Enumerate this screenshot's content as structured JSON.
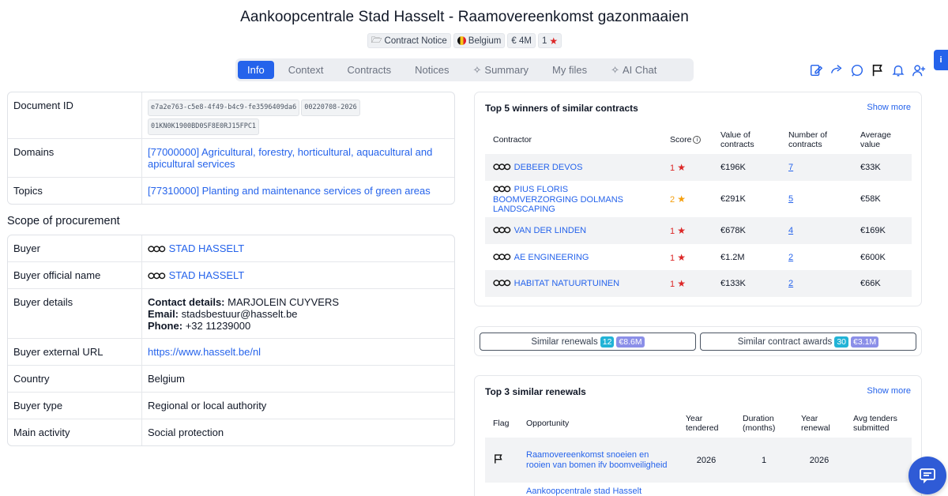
{
  "title": "Aankoopcentrale Stad Hasselt - Raamovereenkomst gazonmaaien",
  "badges": {
    "type": "Contract Notice",
    "country": "Belgium",
    "value": "€ 4M",
    "score": "1"
  },
  "tabs": [
    "Info",
    "Context",
    "Contracts",
    "Notices",
    "Summary",
    "My files",
    "AI Chat"
  ],
  "actions": [
    "edit-icon",
    "share-icon",
    "comment-icon",
    "flag-icon",
    "bell-icon",
    "add-user-icon"
  ],
  "info_tab": "i",
  "details": {
    "document_id_label": "Document ID",
    "document_ids": [
      "e7a2e763-c5e8-4f49-b4c9-fe3596409da6",
      "00220708-2026",
      "01KN0K1900BD0SF8E0RJ15FPC1"
    ],
    "domains_label": "Domains",
    "domains_value": "[77000000] Agricultural, forestry, horticultural, aquacultural and apicultural services",
    "topics_label": "Topics",
    "topics_value": "[77310000] Planting and maintenance services of green areas"
  },
  "scope": {
    "title": "Scope of procurement",
    "buyer_label": "Buyer",
    "buyer_value": "STAD HASSELT",
    "official_name_label": "Buyer official name",
    "official_name_value": "STAD HASSELT",
    "details_label": "Buyer details",
    "contact_label": "Contact details:",
    "contact_value": "MARJOLEIN CUYVERS",
    "email_label": "Email:",
    "email_value": "stadsbestuur@hasselt.be",
    "phone_label": "Phone:",
    "phone_value": "+32 11239000",
    "url_label": "Buyer external URL",
    "url_value": "https://www.hasselt.be/nl",
    "country_label": "Country",
    "country_value": "Belgium",
    "type_label": "Buyer type",
    "type_value": "Regional or local authority",
    "activity_label": "Main activity",
    "activity_value": "Social protection"
  },
  "winners": {
    "title": "Top 5 winners of similar contracts",
    "show_more": "Show more",
    "headers": [
      "Contractor",
      "Score",
      "Value of contracts",
      "Number of contracts",
      "Average value"
    ],
    "rows": [
      {
        "name": "DEBEER DEVOS",
        "score": "1",
        "value": "€196K",
        "count": "7",
        "avg": "€33K"
      },
      {
        "name": "PIUS FLORIS BOOMVERZORGING DOLMANS LANDSCAPING",
        "score": "2",
        "value": "€291K",
        "count": "5",
        "avg": "€58K"
      },
      {
        "name": "VAN DER LINDEN",
        "score": "1",
        "value": "€678K",
        "count": "4",
        "avg": "€169K"
      },
      {
        "name": "AE ENGINEERING",
        "score": "1",
        "value": "€1.2M",
        "count": "2",
        "avg": "€600K"
      },
      {
        "name": "HABITAT NATUURTUINEN",
        "score": "1",
        "value": "€133K",
        "count": "2",
        "avg": "€66K"
      }
    ]
  },
  "similar": {
    "renewals_label": "Similar renewals",
    "renewals_count": "12",
    "renewals_amount": "€8.6M",
    "awards_label": "Similar contract awards",
    "awards_count": "30",
    "awards_amount": "€3.1M"
  },
  "renewals": {
    "title": "Top 3 similar renewals",
    "show_more": "Show more",
    "headers": [
      "Flag",
      "Opportunity",
      "Year tendered",
      "Duration (months)",
      "Year renewal",
      "Avg tenders submitted"
    ],
    "rows": [
      {
        "opportunity": "Raamovereenkomst snoeien en rooien van bomen ifv boomveiligheid",
        "year": "2026",
        "duration": "1",
        "renewal": "2026",
        "avg": ""
      },
      {
        "opportunity": "Aankoopcentrale stad Hasselt",
        "year": "",
        "duration": "",
        "renewal": "",
        "avg": ""
      }
    ]
  },
  "colors": {
    "accent": "#2563eb",
    "star_red": "#dc2626",
    "star_orange": "#f59e0b",
    "count_cyan": "#22b3d6",
    "amount_violet": "#8b8fe8"
  }
}
